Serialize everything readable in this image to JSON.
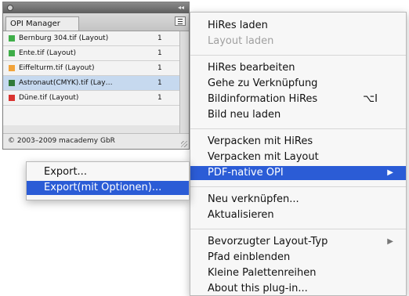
{
  "panel": {
    "title_collapse_glyph": "◂◂",
    "tab_label": "OPI Manager",
    "menu_button_icon": "panel-menu-icon",
    "rows": [
      {
        "color": "#3fae49",
        "name": "Bernburg 304.tif (Layout)",
        "count": "1",
        "selected": false
      },
      {
        "color": "#3fae49",
        "name": "Ente.tif (Layout)",
        "count": "1",
        "selected": false
      },
      {
        "color": "#f2a33a",
        "name": "Eiffelturm.tif (Layout)",
        "count": "1",
        "selected": false
      },
      {
        "color": "#2f7a3a",
        "name": "Astronaut(CMYK).tif (Lay…",
        "count": "1",
        "selected": true
      },
      {
        "color": "#d9332f",
        "name": "Düne.tif (Layout)",
        "count": "1",
        "selected": false
      }
    ],
    "footer": "© 2003–2009 macademy GbR"
  },
  "main_menu": {
    "items": [
      {
        "label": "HiRes laden",
        "disabled": false
      },
      {
        "label": "Layout laden",
        "disabled": true
      },
      {
        "separator": true
      },
      {
        "label": "HiRes bearbeiten",
        "disabled": false
      },
      {
        "label": "Gehe zu Verknüpfung",
        "disabled": false
      },
      {
        "label": "Bildinformation HiRes",
        "disabled": false,
        "shortcut": "⌥I"
      },
      {
        "label": "Bild neu laden",
        "disabled": false
      },
      {
        "separator": true
      },
      {
        "label": "Verpacken mit HiRes",
        "disabled": false
      },
      {
        "label": "Verpacken mit Layout",
        "disabled": false
      },
      {
        "label": "PDF-native OPI",
        "disabled": false,
        "submenu": true,
        "highlight": true
      },
      {
        "separator": true
      },
      {
        "label": "Neu verknüpfen...",
        "disabled": false
      },
      {
        "label": "Aktualisieren",
        "disabled": false
      },
      {
        "separator": true
      },
      {
        "label": "Bevorzugter Layout-Typ",
        "disabled": false,
        "submenu": true
      },
      {
        "label": "Pfad einblenden",
        "disabled": false
      },
      {
        "label": "Kleine Palettenreihen",
        "disabled": false
      },
      {
        "label": "About this plug-in...",
        "disabled": false
      }
    ],
    "submenu_arrow": "▶"
  },
  "export_menu": {
    "items": [
      {
        "label": "Export...",
        "highlight": false
      },
      {
        "label": "Export(mit Optionen)...",
        "highlight": true
      }
    ]
  },
  "colors": {
    "highlight": "#2b5cd6",
    "selected_row": "#c6d9ef"
  }
}
